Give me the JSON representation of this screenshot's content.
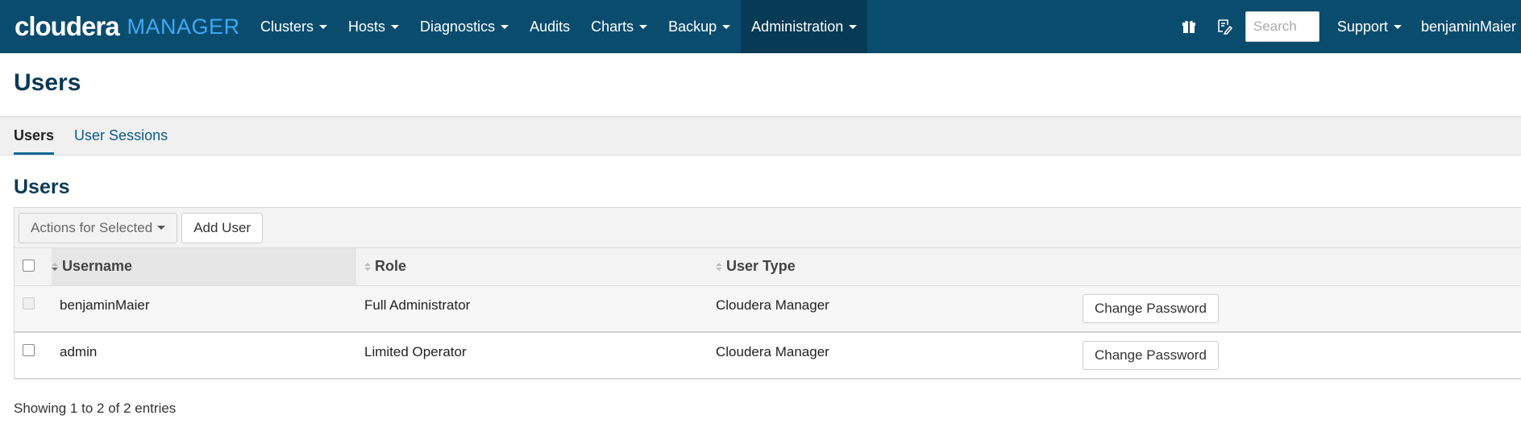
{
  "brand": {
    "name": "cloudera",
    "product": "MANAGER"
  },
  "nav": {
    "items": [
      {
        "label": "Clusters",
        "dropdown": true
      },
      {
        "label": "Hosts",
        "dropdown": true
      },
      {
        "label": "Diagnostics",
        "dropdown": true
      },
      {
        "label": "Audits",
        "dropdown": false
      },
      {
        "label": "Charts",
        "dropdown": true
      },
      {
        "label": "Backup",
        "dropdown": true
      },
      {
        "label": "Administration",
        "dropdown": true,
        "active": true
      }
    ],
    "right": {
      "icons": [
        "gift-icon",
        "pen-notes-icon"
      ],
      "search_placeholder": "Search",
      "support_label": "Support",
      "user_label": "benjaminMaier"
    }
  },
  "page": {
    "title": "Users"
  },
  "tabs": [
    {
      "label": "Users",
      "active": true
    },
    {
      "label": "User Sessions",
      "active": false
    }
  ],
  "section": {
    "title": "Users"
  },
  "toolbar": {
    "actions_label": "Actions for Selected",
    "add_user_label": "Add User"
  },
  "table": {
    "columns": [
      "Username",
      "Role",
      "User Type"
    ],
    "rows": [
      {
        "username": "benjaminMaier",
        "role": "Full Administrator",
        "user_type": "Cloudera Manager",
        "action": "Change Password",
        "checkbox_disabled": true
      },
      {
        "username": "admin",
        "role": "Limited Operator",
        "user_type": "Cloudera Manager",
        "action": "Change Password",
        "checkbox_disabled": false
      }
    ]
  },
  "footer": {
    "info": "Showing 1 to 2 of 2 entries"
  },
  "colors": {
    "navbar": "#0a4c6e",
    "navbar_active": "#063a55",
    "brand_accent": "#3fa9f5",
    "link": "#0a5a85"
  }
}
